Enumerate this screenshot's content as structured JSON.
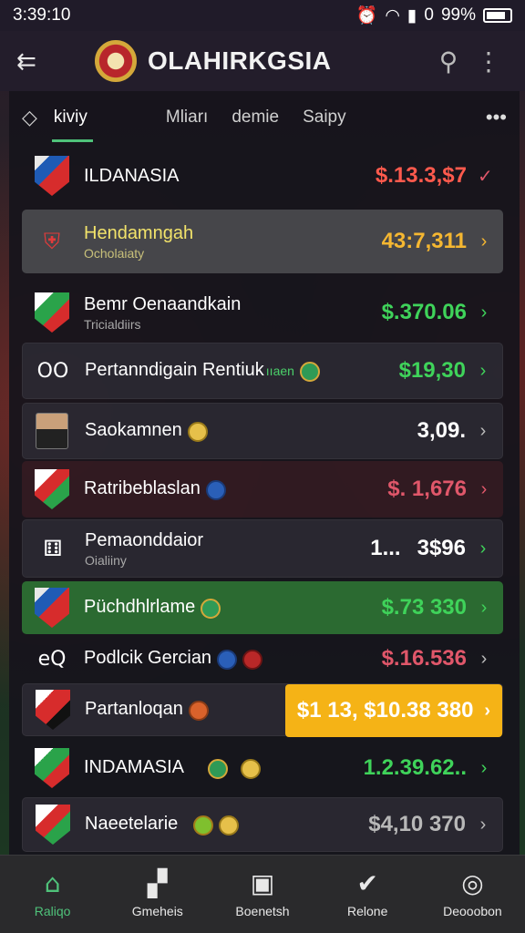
{
  "status_bar": {
    "time": "3:39:10",
    "battery": "99%",
    "signal_zero": "0"
  },
  "app_bar": {
    "title": "OLAHIRKGSIA"
  },
  "filters": {
    "tabs": [
      "kiviy",
      "Mliarı",
      "demie",
      "Saipy"
    ]
  },
  "rows": [
    {
      "name": "ILDANASIA",
      "value": "$.13.3,$7",
      "value_color": "red"
    },
    {
      "name": "Hendamngah",
      "sub": "Ocholaiaty",
      "value": "43:7,311"
    },
    {
      "name": "Bemr Oenaandkain",
      "sub": "Tricialdiirs",
      "value": "$.370.06"
    },
    {
      "prefix": "OO",
      "name": "Pertanndigain Rentiuk",
      "note": "ııaen",
      "value": "$19,30"
    },
    {
      "name": "Saokamnen",
      "value": "3,09."
    },
    {
      "name": "Ratribeblaslan",
      "value": "$. 1,676"
    },
    {
      "name": "Pemaonddaior",
      "sub": "Oialiiny",
      "value_left": "1...",
      "value": "3$96"
    },
    {
      "name": "Püchdhlrlame",
      "value": "$.73 330"
    },
    {
      "prefix": "eQ",
      "name": "Podlcik Gercian",
      "value": "$.16.536"
    },
    {
      "name": "Partanloqan",
      "value": "$1 13, $10.38 380"
    },
    {
      "name": "INDAMASIA",
      "value": "1.2.39.62.."
    },
    {
      "name": "Naeetelarie",
      "value": "$4,10 370"
    }
  ],
  "bottom_nav": [
    {
      "label": "Raliqo",
      "icon": "home-icon"
    },
    {
      "label": "Gmeheis",
      "icon": "cards-icon"
    },
    {
      "label": "Boenetsh",
      "icon": "ticket-icon"
    },
    {
      "label": "Relone",
      "icon": "check-badge-icon"
    },
    {
      "label": "Deooobon",
      "icon": "profile-icon"
    }
  ]
}
